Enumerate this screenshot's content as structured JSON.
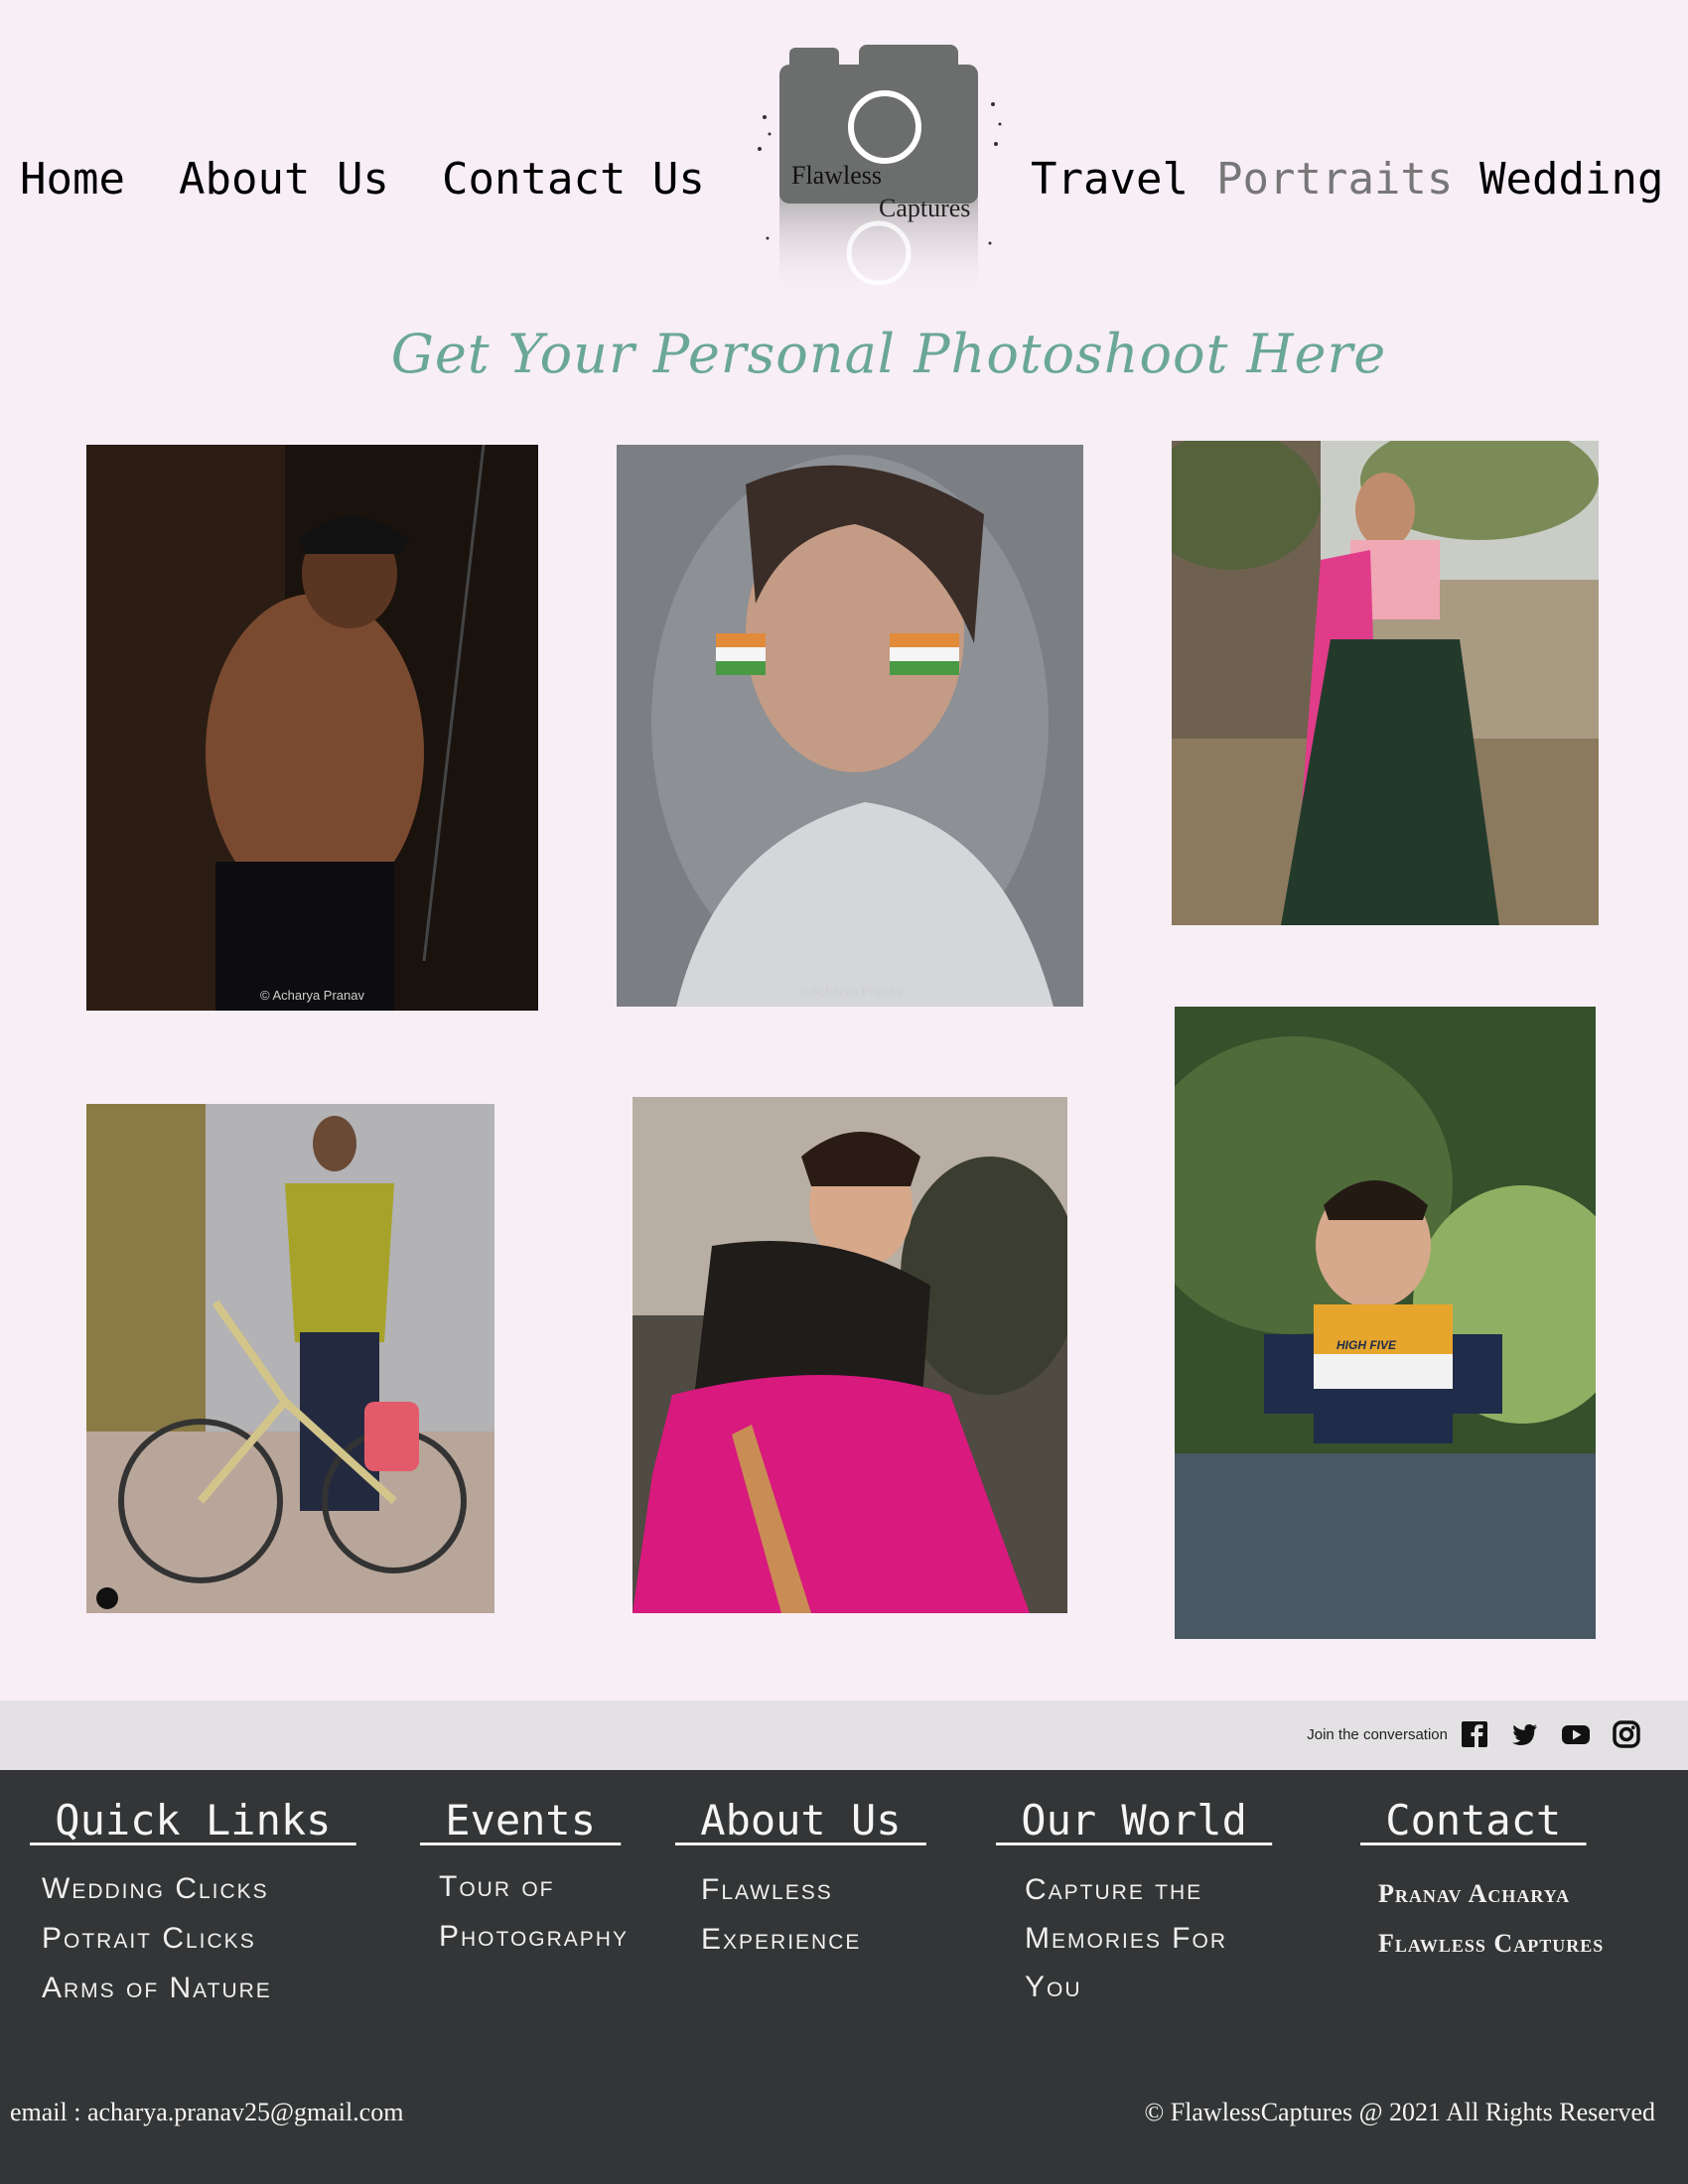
{
  "nav": {
    "left": [
      "Home",
      "About Us",
      "Contact Us"
    ],
    "right": [
      "Travel",
      "Portraits",
      "Wedding"
    ]
  },
  "logo": {
    "line1": "Flawless",
    "line2": "Captures",
    "icon": "camera-logo-icon"
  },
  "headline": "Get Your Personal Photoshoot Here",
  "gallery": {
    "watermarks": [
      "© Acharya Pranav",
      "© Acharya Pranav"
    ],
    "badge_text": "HIGH FIVE"
  },
  "social": {
    "label": "Join the conversation",
    "icons": [
      "facebook-icon",
      "twitter-icon",
      "youtube-icon",
      "instagram-icon"
    ]
  },
  "footer": {
    "quick_links": {
      "heading": " Quick Links ",
      "items": [
        "Wedding  Clicks",
        "Potrait  Clicks",
        "Arms  of  Nature"
      ]
    },
    "events": {
      "heading": " Events ",
      "items": [
        "Tour  of",
        "Photography"
      ]
    },
    "about": {
      "heading": " About Us ",
      "items": [
        "Flawless",
        "Experience"
      ]
    },
    "world": {
      "heading": " Our World ",
      "items": [
        "Capture  the",
        "Memories  For",
        "You"
      ]
    },
    "contact": {
      "heading": " Contact ",
      "items": [
        "Pranav Acharya",
        "Flawless Captures"
      ]
    },
    "email": "email : acharya.pranav25@gmail.com",
    "copyright": "© FlawlessCaptures @ 2021 All Rights Reserved"
  },
  "colors": {
    "background": "#f7eef6",
    "headline": "#6aa796",
    "footer": "#333536",
    "social_bar": "#e3e1e3"
  }
}
